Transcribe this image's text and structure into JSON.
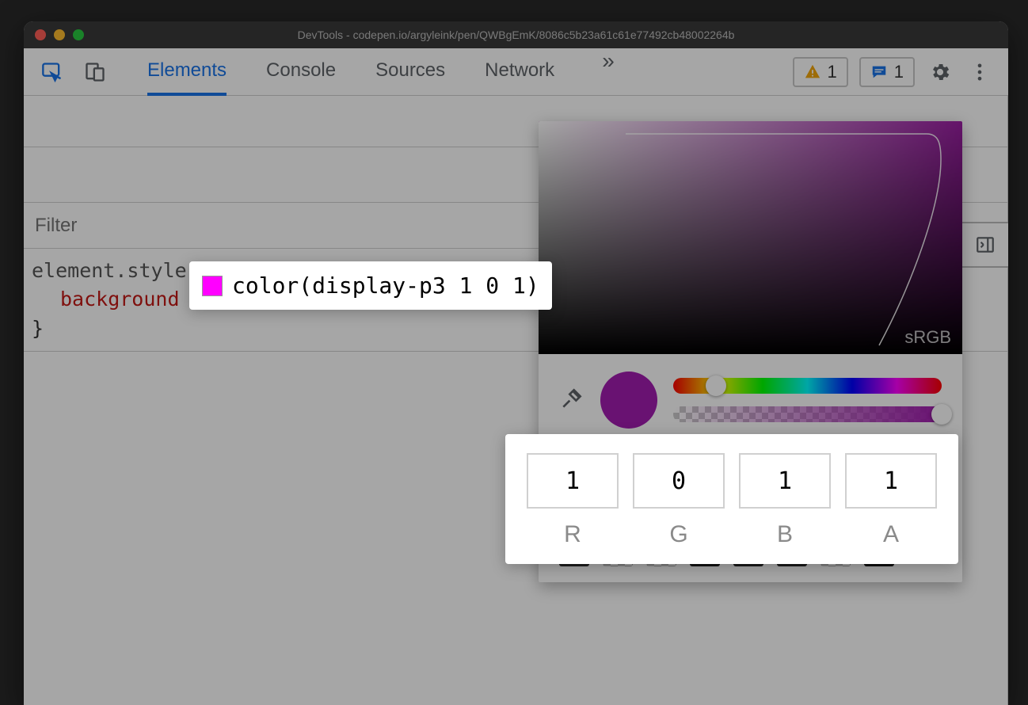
{
  "window": {
    "title": "DevTools - codepen.io/argyleink/pen/QWBgEmK/8086c5b23a61c61e77492cb48002264b"
  },
  "toolbar": {
    "tabs": [
      "Elements",
      "Console",
      "Sources",
      "Network"
    ],
    "active_tab_index": 0,
    "warning_count": "1",
    "message_count": "1"
  },
  "styles": {
    "filter_placeholder": "Filter",
    "selector": "element.style {",
    "property": "background",
    "close_brace": "}"
  },
  "css_value_popup": {
    "value": "color(display-p3 1 0 1)",
    "swatch_color": "#ff00ff"
  },
  "picker": {
    "gamut_label": "sRGB",
    "hue_thumb_pct": 16,
    "alpha_thumb_pct": 100,
    "current_color": "#a21caf",
    "swatch_rows": [
      [
        "#a9a0e6",
        "#000000",
        "#1c1c1c",
        "#e8d100",
        "#c9a500",
        "checker",
        "checker",
        "#b3b3b3"
      ],
      [
        "#bdbdbd",
        "#4a4a4a",
        "#3a3a3a",
        "#2a2a2a",
        "checker",
        "checker",
        "#000000",
        "checker"
      ],
      [
        "#2e2e2e",
        "checker",
        "checker",
        "#1f1f1f",
        "#2a2a2a",
        "#2a2a2a",
        "checker",
        "#1a1a1a"
      ]
    ]
  },
  "rgba": {
    "fields": [
      {
        "label": "R",
        "value": "1"
      },
      {
        "label": "G",
        "value": "0"
      },
      {
        "label": "B",
        "value": "1"
      },
      {
        "label": "A",
        "value": "1"
      }
    ]
  }
}
